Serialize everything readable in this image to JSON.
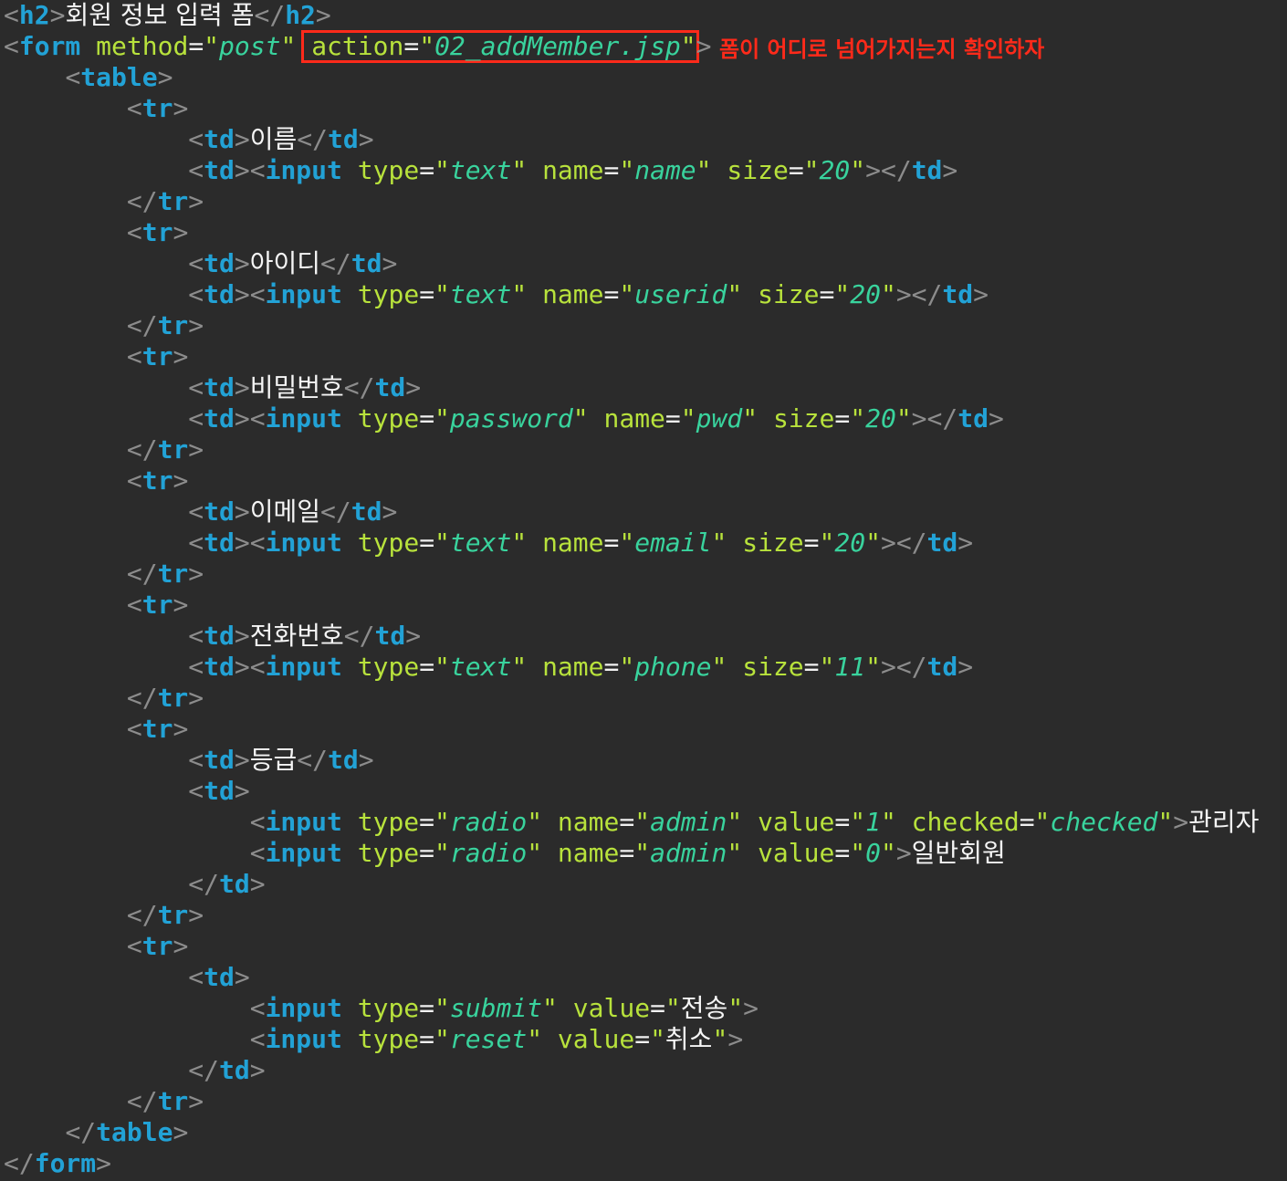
{
  "annotation": {
    "note": "폼이 어디로 넘어가지는지 확인하자",
    "highlight_color": "#ff2a1a"
  },
  "colors": {
    "background": "#2b2b2b",
    "tag": "#22a2d6",
    "attribute": "#b8e23c",
    "value": "#39d39d",
    "punctuation": "#8c8c8c"
  },
  "code_lines": [
    [
      [
        "p",
        "<"
      ],
      [
        "t",
        "h2"
      ],
      [
        "p",
        ">"
      ],
      [
        "k",
        "회원 정보 입력 폼"
      ],
      [
        "p",
        "</"
      ],
      [
        "t",
        "h2"
      ],
      [
        "p",
        ">"
      ]
    ],
    [
      [
        "p",
        "<"
      ],
      [
        "t",
        "form"
      ],
      [
        "x",
        " "
      ],
      [
        "a",
        "method"
      ],
      [
        "eq",
        "="
      ],
      [
        "q",
        "\""
      ],
      [
        "v",
        "post"
      ],
      [
        "q",
        "\""
      ],
      [
        "x",
        " "
      ],
      [
        "a",
        "action"
      ],
      [
        "eq",
        "="
      ],
      [
        "q",
        "\""
      ],
      [
        "v",
        "02_addMember.jsp"
      ],
      [
        "q",
        "\""
      ],
      [
        "p",
        ">"
      ]
    ],
    [
      [
        "x",
        "    "
      ],
      [
        "p",
        "<"
      ],
      [
        "t",
        "table"
      ],
      [
        "p",
        ">"
      ]
    ],
    [
      [
        "x",
        "        "
      ],
      [
        "p",
        "<"
      ],
      [
        "t",
        "tr"
      ],
      [
        "p",
        ">"
      ]
    ],
    [
      [
        "x",
        "            "
      ],
      [
        "p",
        "<"
      ],
      [
        "t",
        "td"
      ],
      [
        "p",
        ">"
      ],
      [
        "k",
        "이름"
      ],
      [
        "p",
        "</"
      ],
      [
        "t",
        "td"
      ],
      [
        "p",
        ">"
      ]
    ],
    [
      [
        "x",
        "            "
      ],
      [
        "p",
        "<"
      ],
      [
        "t",
        "td"
      ],
      [
        "p",
        "><"
      ],
      [
        "t",
        "input"
      ],
      [
        "x",
        " "
      ],
      [
        "a",
        "type"
      ],
      [
        "eq",
        "="
      ],
      [
        "q",
        "\""
      ],
      [
        "v",
        "text"
      ],
      [
        "q",
        "\""
      ],
      [
        "x",
        " "
      ],
      [
        "a",
        "name"
      ],
      [
        "eq",
        "="
      ],
      [
        "q",
        "\""
      ],
      [
        "v",
        "name"
      ],
      [
        "q",
        "\""
      ],
      [
        "x",
        " "
      ],
      [
        "a",
        "size"
      ],
      [
        "eq",
        "="
      ],
      [
        "q",
        "\""
      ],
      [
        "v",
        "20"
      ],
      [
        "q",
        "\""
      ],
      [
        "p",
        "></"
      ],
      [
        "t",
        "td"
      ],
      [
        "p",
        ">"
      ]
    ],
    [
      [
        "x",
        "        "
      ],
      [
        "p",
        "</"
      ],
      [
        "t",
        "tr"
      ],
      [
        "p",
        ">"
      ]
    ],
    [
      [
        "x",
        "        "
      ],
      [
        "p",
        "<"
      ],
      [
        "t",
        "tr"
      ],
      [
        "p",
        ">"
      ]
    ],
    [
      [
        "x",
        "            "
      ],
      [
        "p",
        "<"
      ],
      [
        "t",
        "td"
      ],
      [
        "p",
        ">"
      ],
      [
        "k",
        "아이디"
      ],
      [
        "p",
        "</"
      ],
      [
        "t",
        "td"
      ],
      [
        "p",
        ">"
      ]
    ],
    [
      [
        "x",
        "            "
      ],
      [
        "p",
        "<"
      ],
      [
        "t",
        "td"
      ],
      [
        "p",
        "><"
      ],
      [
        "t",
        "input"
      ],
      [
        "x",
        " "
      ],
      [
        "a",
        "type"
      ],
      [
        "eq",
        "="
      ],
      [
        "q",
        "\""
      ],
      [
        "v",
        "text"
      ],
      [
        "q",
        "\""
      ],
      [
        "x",
        " "
      ],
      [
        "a",
        "name"
      ],
      [
        "eq",
        "="
      ],
      [
        "q",
        "\""
      ],
      [
        "v",
        "userid"
      ],
      [
        "q",
        "\""
      ],
      [
        "x",
        " "
      ],
      [
        "a",
        "size"
      ],
      [
        "eq",
        "="
      ],
      [
        "q",
        "\""
      ],
      [
        "v",
        "20"
      ],
      [
        "q",
        "\""
      ],
      [
        "p",
        "></"
      ],
      [
        "t",
        "td"
      ],
      [
        "p",
        ">"
      ]
    ],
    [
      [
        "x",
        "        "
      ],
      [
        "p",
        "</"
      ],
      [
        "t",
        "tr"
      ],
      [
        "p",
        ">"
      ]
    ],
    [
      [
        "x",
        "        "
      ],
      [
        "p",
        "<"
      ],
      [
        "t",
        "tr"
      ],
      [
        "p",
        ">"
      ]
    ],
    [
      [
        "x",
        "            "
      ],
      [
        "p",
        "<"
      ],
      [
        "t",
        "td"
      ],
      [
        "p",
        ">"
      ],
      [
        "k",
        "비밀번호"
      ],
      [
        "p",
        "</"
      ],
      [
        "t",
        "td"
      ],
      [
        "p",
        ">"
      ]
    ],
    [
      [
        "x",
        "            "
      ],
      [
        "p",
        "<"
      ],
      [
        "t",
        "td"
      ],
      [
        "p",
        "><"
      ],
      [
        "t",
        "input"
      ],
      [
        "x",
        " "
      ],
      [
        "a",
        "type"
      ],
      [
        "eq",
        "="
      ],
      [
        "q",
        "\""
      ],
      [
        "v",
        "password"
      ],
      [
        "q",
        "\""
      ],
      [
        "x",
        " "
      ],
      [
        "a",
        "name"
      ],
      [
        "eq",
        "="
      ],
      [
        "q",
        "\""
      ],
      [
        "v",
        "pwd"
      ],
      [
        "q",
        "\""
      ],
      [
        "x",
        " "
      ],
      [
        "a",
        "size"
      ],
      [
        "eq",
        "="
      ],
      [
        "q",
        "\""
      ],
      [
        "v",
        "20"
      ],
      [
        "q",
        "\""
      ],
      [
        "p",
        "></"
      ],
      [
        "t",
        "td"
      ],
      [
        "p",
        ">"
      ]
    ],
    [
      [
        "x",
        "        "
      ],
      [
        "p",
        "</"
      ],
      [
        "t",
        "tr"
      ],
      [
        "p",
        ">"
      ]
    ],
    [
      [
        "x",
        "        "
      ],
      [
        "p",
        "<"
      ],
      [
        "t",
        "tr"
      ],
      [
        "p",
        ">"
      ]
    ],
    [
      [
        "x",
        "            "
      ],
      [
        "p",
        "<"
      ],
      [
        "t",
        "td"
      ],
      [
        "p",
        ">"
      ],
      [
        "k",
        "이메일"
      ],
      [
        "p",
        "</"
      ],
      [
        "t",
        "td"
      ],
      [
        "p",
        ">"
      ]
    ],
    [
      [
        "x",
        "            "
      ],
      [
        "p",
        "<"
      ],
      [
        "t",
        "td"
      ],
      [
        "p",
        "><"
      ],
      [
        "t",
        "input"
      ],
      [
        "x",
        " "
      ],
      [
        "a",
        "type"
      ],
      [
        "eq",
        "="
      ],
      [
        "q",
        "\""
      ],
      [
        "v",
        "text"
      ],
      [
        "q",
        "\""
      ],
      [
        "x",
        " "
      ],
      [
        "a",
        "name"
      ],
      [
        "eq",
        "="
      ],
      [
        "q",
        "\""
      ],
      [
        "v",
        "email"
      ],
      [
        "q",
        "\""
      ],
      [
        "x",
        " "
      ],
      [
        "a",
        "size"
      ],
      [
        "eq",
        "="
      ],
      [
        "q",
        "\""
      ],
      [
        "v",
        "20"
      ],
      [
        "q",
        "\""
      ],
      [
        "p",
        "></"
      ],
      [
        "t",
        "td"
      ],
      [
        "p",
        ">"
      ]
    ],
    [
      [
        "x",
        "        "
      ],
      [
        "p",
        "</"
      ],
      [
        "t",
        "tr"
      ],
      [
        "p",
        ">"
      ]
    ],
    [
      [
        "x",
        "        "
      ],
      [
        "p",
        "<"
      ],
      [
        "t",
        "tr"
      ],
      [
        "p",
        ">"
      ]
    ],
    [
      [
        "x",
        "            "
      ],
      [
        "p",
        "<"
      ],
      [
        "t",
        "td"
      ],
      [
        "p",
        ">"
      ],
      [
        "k",
        "전화번호"
      ],
      [
        "p",
        "</"
      ],
      [
        "t",
        "td"
      ],
      [
        "p",
        ">"
      ]
    ],
    [
      [
        "x",
        "            "
      ],
      [
        "p",
        "<"
      ],
      [
        "t",
        "td"
      ],
      [
        "p",
        "><"
      ],
      [
        "t",
        "input"
      ],
      [
        "x",
        " "
      ],
      [
        "a",
        "type"
      ],
      [
        "eq",
        "="
      ],
      [
        "q",
        "\""
      ],
      [
        "v",
        "text"
      ],
      [
        "q",
        "\""
      ],
      [
        "x",
        " "
      ],
      [
        "a",
        "name"
      ],
      [
        "eq",
        "="
      ],
      [
        "q",
        "\""
      ],
      [
        "v",
        "phone"
      ],
      [
        "q",
        "\""
      ],
      [
        "x",
        " "
      ],
      [
        "a",
        "size"
      ],
      [
        "eq",
        "="
      ],
      [
        "q",
        "\""
      ],
      [
        "v",
        "11"
      ],
      [
        "q",
        "\""
      ],
      [
        "p",
        "></"
      ],
      [
        "t",
        "td"
      ],
      [
        "p",
        ">"
      ]
    ],
    [
      [
        "x",
        "        "
      ],
      [
        "p",
        "</"
      ],
      [
        "t",
        "tr"
      ],
      [
        "p",
        ">"
      ]
    ],
    [
      [
        "x",
        "        "
      ],
      [
        "p",
        "<"
      ],
      [
        "t",
        "tr"
      ],
      [
        "p",
        ">"
      ]
    ],
    [
      [
        "x",
        "            "
      ],
      [
        "p",
        "<"
      ],
      [
        "t",
        "td"
      ],
      [
        "p",
        ">"
      ],
      [
        "k",
        "등급"
      ],
      [
        "p",
        "</"
      ],
      [
        "t",
        "td"
      ],
      [
        "p",
        ">"
      ]
    ],
    [
      [
        "x",
        "            "
      ],
      [
        "p",
        "<"
      ],
      [
        "t",
        "td"
      ],
      [
        "p",
        ">"
      ]
    ],
    [
      [
        "x",
        "                "
      ],
      [
        "p",
        "<"
      ],
      [
        "t",
        "input"
      ],
      [
        "x",
        " "
      ],
      [
        "a",
        "type"
      ],
      [
        "eq",
        "="
      ],
      [
        "q",
        "\""
      ],
      [
        "v",
        "radio"
      ],
      [
        "q",
        "\""
      ],
      [
        "x",
        " "
      ],
      [
        "a",
        "name"
      ],
      [
        "eq",
        "="
      ],
      [
        "q",
        "\""
      ],
      [
        "v",
        "admin"
      ],
      [
        "q",
        "\""
      ],
      [
        "x",
        " "
      ],
      [
        "a",
        "value"
      ],
      [
        "eq",
        "="
      ],
      [
        "q",
        "\""
      ],
      [
        "v",
        "1"
      ],
      [
        "q",
        "\""
      ],
      [
        "x",
        " "
      ],
      [
        "a",
        "checked"
      ],
      [
        "eq",
        "="
      ],
      [
        "q",
        "\""
      ],
      [
        "v",
        "checked"
      ],
      [
        "q",
        "\""
      ],
      [
        "p",
        ">"
      ],
      [
        "k",
        "관리자"
      ]
    ],
    [
      [
        "x",
        "                "
      ],
      [
        "p",
        "<"
      ],
      [
        "t",
        "input"
      ],
      [
        "x",
        " "
      ],
      [
        "a",
        "type"
      ],
      [
        "eq",
        "="
      ],
      [
        "q",
        "\""
      ],
      [
        "v",
        "radio"
      ],
      [
        "q",
        "\""
      ],
      [
        "x",
        " "
      ],
      [
        "a",
        "name"
      ],
      [
        "eq",
        "="
      ],
      [
        "q",
        "\""
      ],
      [
        "v",
        "admin"
      ],
      [
        "q",
        "\""
      ],
      [
        "x",
        " "
      ],
      [
        "a",
        "value"
      ],
      [
        "eq",
        "="
      ],
      [
        "q",
        "\""
      ],
      [
        "v",
        "0"
      ],
      [
        "q",
        "\""
      ],
      [
        "p",
        ">"
      ],
      [
        "k",
        "일반회원"
      ]
    ],
    [
      [
        "x",
        "            "
      ],
      [
        "p",
        "</"
      ],
      [
        "t",
        "td"
      ],
      [
        "p",
        ">"
      ]
    ],
    [
      [
        "x",
        "        "
      ],
      [
        "p",
        "</"
      ],
      [
        "t",
        "tr"
      ],
      [
        "p",
        ">"
      ]
    ],
    [
      [
        "x",
        "        "
      ],
      [
        "p",
        "<"
      ],
      [
        "t",
        "tr"
      ],
      [
        "p",
        ">"
      ]
    ],
    [
      [
        "x",
        "            "
      ],
      [
        "p",
        "<"
      ],
      [
        "t",
        "td"
      ],
      [
        "p",
        ">"
      ]
    ],
    [
      [
        "x",
        "                "
      ],
      [
        "p",
        "<"
      ],
      [
        "t",
        "input"
      ],
      [
        "x",
        " "
      ],
      [
        "a",
        "type"
      ],
      [
        "eq",
        "="
      ],
      [
        "q",
        "\""
      ],
      [
        "v",
        "submit"
      ],
      [
        "q",
        "\""
      ],
      [
        "x",
        " "
      ],
      [
        "a",
        "value"
      ],
      [
        "eq",
        "="
      ],
      [
        "q",
        "\""
      ],
      [
        "k",
        "전송"
      ],
      [
        "q",
        "\""
      ],
      [
        "p",
        ">"
      ]
    ],
    [
      [
        "x",
        "                "
      ],
      [
        "p",
        "<"
      ],
      [
        "t",
        "input"
      ],
      [
        "x",
        " "
      ],
      [
        "a",
        "type"
      ],
      [
        "eq",
        "="
      ],
      [
        "q",
        "\""
      ],
      [
        "v",
        "reset"
      ],
      [
        "q",
        "\""
      ],
      [
        "x",
        " "
      ],
      [
        "a",
        "value"
      ],
      [
        "eq",
        "="
      ],
      [
        "q",
        "\""
      ],
      [
        "k",
        "취소"
      ],
      [
        "q",
        "\""
      ],
      [
        "p",
        ">"
      ]
    ],
    [
      [
        "x",
        "            "
      ],
      [
        "p",
        "</"
      ],
      [
        "t",
        "td"
      ],
      [
        "p",
        ">"
      ]
    ],
    [
      [
        "x",
        "        "
      ],
      [
        "p",
        "</"
      ],
      [
        "t",
        "tr"
      ],
      [
        "p",
        ">"
      ]
    ],
    [
      [
        "x",
        "    "
      ],
      [
        "p",
        "</"
      ],
      [
        "t",
        "table"
      ],
      [
        "p",
        ">"
      ]
    ],
    [
      [
        "p",
        "</"
      ],
      [
        "t",
        "form"
      ],
      [
        "p",
        ">"
      ]
    ]
  ]
}
